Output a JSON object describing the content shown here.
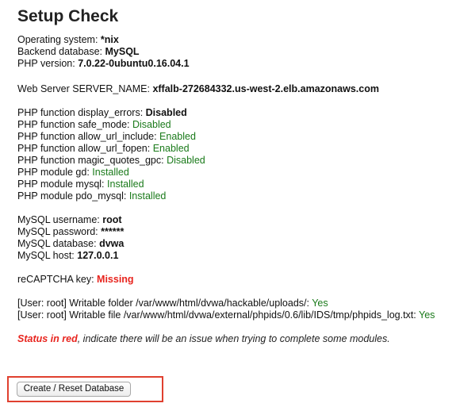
{
  "title": "Setup Check",
  "system": {
    "os_label": "Operating system: ",
    "os_value": "*nix",
    "db_label": "Backend database: ",
    "db_value": "MySQL",
    "php_label": "PHP version: ",
    "php_value": "7.0.22-0ubuntu0.16.04.1"
  },
  "webserver": {
    "label": "Web Server SERVER_NAME: ",
    "value": "xffalb-272684332.us-west-2.elb.amazonaws.com"
  },
  "php_checks": [
    {
      "label": "PHP function display_errors: ",
      "value": "Disabled",
      "style": "bold"
    },
    {
      "label": "PHP function safe_mode: ",
      "value": "Disabled",
      "style": "green"
    },
    {
      "label": "PHP function allow_url_include: ",
      "value": "Enabled",
      "style": "green"
    },
    {
      "label": "PHP function allow_url_fopen: ",
      "value": "Enabled",
      "style": "green"
    },
    {
      "label": "PHP function magic_quotes_gpc: ",
      "value": "Disabled",
      "style": "green"
    },
    {
      "label": "PHP module gd: ",
      "value": "Installed",
      "style": "green"
    },
    {
      "label": "PHP module mysql: ",
      "value": "Installed",
      "style": "green"
    },
    {
      "label": "PHP module pdo_mysql: ",
      "value": "Installed",
      "style": "green"
    }
  ],
  "mysql": {
    "username_label": "MySQL username: ",
    "username_value": "root",
    "password_label": "MySQL password: ",
    "password_value": "******",
    "database_label": "MySQL database: ",
    "database_value": "dvwa",
    "host_label": "MySQL host: ",
    "host_value": "127.0.0.1"
  },
  "recaptcha": {
    "label": "reCAPTCHA key: ",
    "value": "Missing"
  },
  "writable": [
    {
      "label": "[User: root] Writable folder /var/www/html/dvwa/hackable/uploads/: ",
      "value": "Yes"
    },
    {
      "label": "[User: root] Writable file /var/www/html/dvwa/external/phpids/0.6/lib/IDS/tmp/phpids_log.txt: ",
      "value": "Yes"
    }
  ],
  "note": {
    "red_part": "Status in red",
    "rest": ", indicate there will be an issue when trying to complete some modules."
  },
  "button": {
    "label": "Create / Reset Database"
  },
  "colors": {
    "ok_green": "#1a7a1a",
    "error_red": "#e8241e",
    "highlight_border": "#e0402f"
  }
}
